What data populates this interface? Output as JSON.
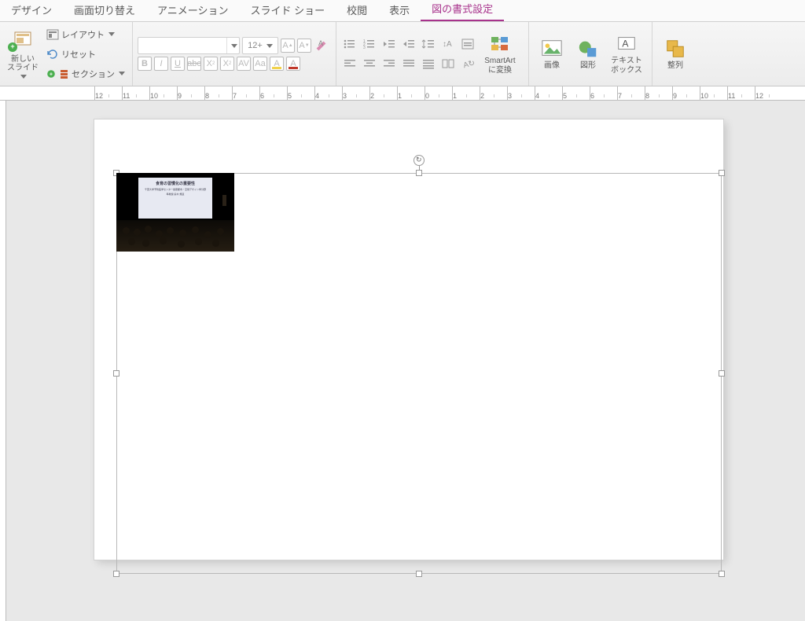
{
  "tabs": {
    "design": "デザイン",
    "transitions": "画面切り替え",
    "animations": "アニメーション",
    "slideshow": "スライド ショー",
    "review": "校閲",
    "view": "表示",
    "picture_format": "図の書式設定"
  },
  "ribbon": {
    "new_slide": "新しい\nスライド",
    "layout": "レイアウト",
    "reset": "リセット",
    "section": "セクション",
    "font_size": "12+",
    "smartart": "SmartArt\nに変換",
    "picture": "画像",
    "shapes": "図形",
    "textbox": "テキスト\nボックス",
    "arrange": "整列"
  },
  "ruler": [
    "12",
    "11",
    "10",
    "9",
    "8",
    "7",
    "6",
    "5",
    "4",
    "3",
    "2",
    "1",
    "0",
    "1",
    "2",
    "3",
    "4",
    "5",
    "6",
    "7",
    "8",
    "9",
    "10",
    "11",
    "12"
  ],
  "slide_image": {
    "screen_title": "食育の習慣化の重要性",
    "screen_sub1": "千葉大学予防医学センター健康都市・空間デザイン学分野",
    "screen_sub2": "準教授 鈴木 規道"
  }
}
